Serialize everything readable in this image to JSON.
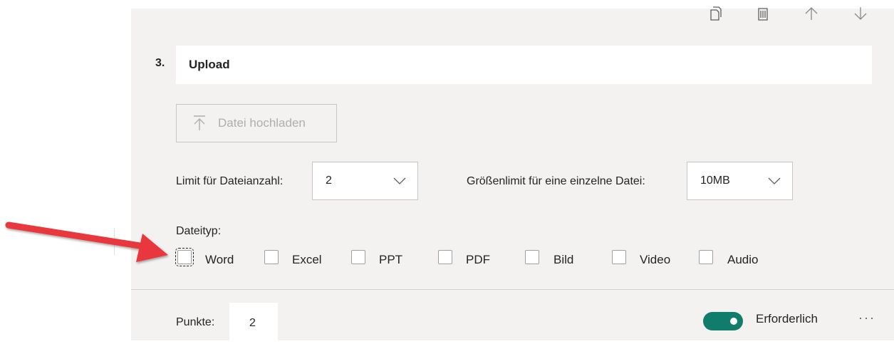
{
  "toolbar": {
    "icons": [
      "copy-icon",
      "delete-icon",
      "move-up-icon",
      "move-down-icon"
    ]
  },
  "question": {
    "number": "3.",
    "title": "Upload"
  },
  "upload_button": {
    "label": "Datei hochladen",
    "icon": "upload-icon"
  },
  "file_count": {
    "label": "Limit für Dateianzahl:",
    "value": "2"
  },
  "file_size": {
    "label": "Größenlimit für eine einzelne Datei:",
    "value": "10MB"
  },
  "file_types": {
    "label": "Dateityp:",
    "options": [
      "Word",
      "Excel",
      "PPT",
      "PDF",
      "Bild",
      "Video",
      "Audio"
    ]
  },
  "points": {
    "label": "Punkte:",
    "value": "2"
  },
  "required": {
    "label": "Erforderlich",
    "on": true
  },
  "more": "···",
  "colors": {
    "accent": "#107c6b",
    "arrow": "#e8373c",
    "card": "#f3f2f1"
  }
}
